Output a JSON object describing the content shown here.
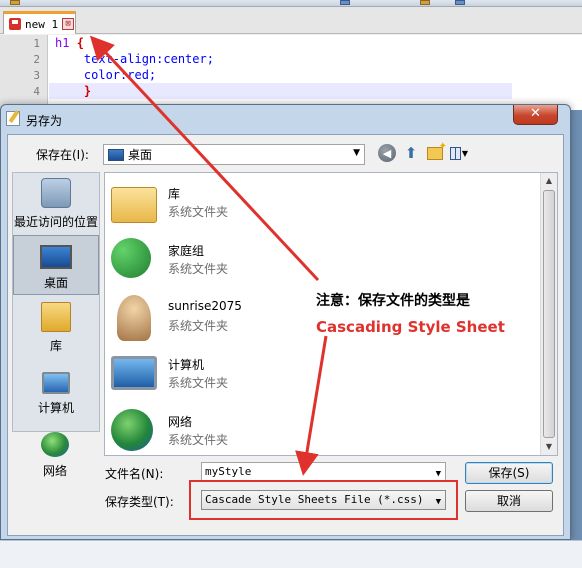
{
  "editor": {
    "tab_label": "new 1",
    "tab_close": "⊠",
    "lines": [
      {
        "num": "1",
        "selector": "h1",
        "brace": "{"
      },
      {
        "num": "2",
        "text": "    text-align:center;"
      },
      {
        "num": "3",
        "text": "    color:red;"
      },
      {
        "num": "4",
        "brace": "    }"
      }
    ]
  },
  "dialog": {
    "title": "另存为",
    "close_glyph": "✕",
    "save_in_label": "保存在(I):",
    "save_in_value": "桌面",
    "places": [
      {
        "label": "最近访问的位置",
        "icon": "recent-places-icon"
      },
      {
        "label": "桌面",
        "icon": "desktop-icon"
      },
      {
        "label": "库",
        "icon": "libraries-icon"
      },
      {
        "label": "计算机",
        "icon": "computer-icon"
      },
      {
        "label": "网络",
        "icon": "network-icon"
      }
    ],
    "files": [
      {
        "name": "库",
        "type": "系统文件夹",
        "icon": "libraries-folder-icon"
      },
      {
        "name": "家庭组",
        "type": "系统文件夹",
        "icon": "homegroup-icon"
      },
      {
        "name": "sunrise2075",
        "type": "系统文件夹",
        "icon": "user-folder-icon"
      },
      {
        "name": "计算机",
        "type": "系统文件夹",
        "icon": "computer-icon"
      },
      {
        "name": "网络",
        "type": "系统文件夹",
        "icon": "network-icon"
      }
    ],
    "filename_label": "文件名(N):",
    "filename_value": "myStyle",
    "filetype_label": "保存类型(T):",
    "filetype_value": "Cascade Style Sheets File (*.css)",
    "save_button": "保存(S)",
    "cancel_button": "取消"
  },
  "annotation": {
    "line1": "注意：保存文件的类型是",
    "line2": "Cascading Style Sheet",
    "color": "#e0322c"
  }
}
